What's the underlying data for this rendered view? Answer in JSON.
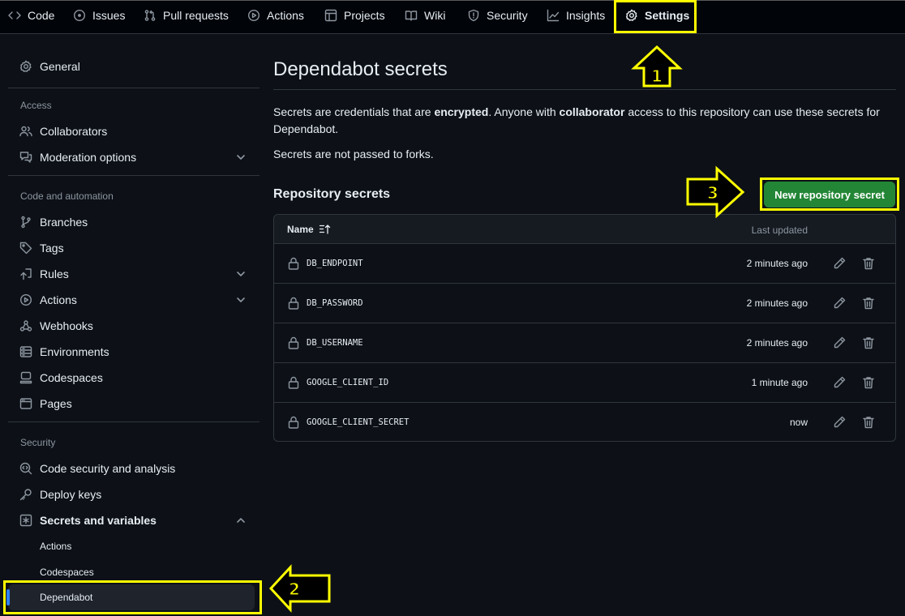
{
  "topnav": {
    "tabs": [
      {
        "label": "Code",
        "icon": "code-icon"
      },
      {
        "label": "Issues",
        "icon": "issue-icon"
      },
      {
        "label": "Pull requests",
        "icon": "pull-request-icon"
      },
      {
        "label": "Actions",
        "icon": "play-icon"
      },
      {
        "label": "Projects",
        "icon": "table-icon"
      },
      {
        "label": "Wiki",
        "icon": "book-icon"
      },
      {
        "label": "Security",
        "icon": "shield-icon"
      },
      {
        "label": "Insights",
        "icon": "graph-icon"
      },
      {
        "label": "Settings",
        "icon": "gear-icon",
        "active": true
      }
    ]
  },
  "sidebar": {
    "general": "General",
    "access_heading": "Access",
    "collaborators": "Collaborators",
    "moderation": "Moderation options",
    "code_heading": "Code and automation",
    "branches": "Branches",
    "tags": "Tags",
    "rules": "Rules",
    "actions": "Actions",
    "webhooks": "Webhooks",
    "environments": "Environments",
    "codespaces": "Codespaces",
    "pages": "Pages",
    "security_heading": "Security",
    "code_security": "Code security and analysis",
    "deploy_keys": "Deploy keys",
    "secrets_vars": "Secrets and variables",
    "sub_actions": "Actions",
    "sub_codespaces": "Codespaces",
    "sub_dependabot": "Dependabot"
  },
  "main": {
    "title": "Dependabot secrets",
    "desc_1": "Secrets are credentials that are ",
    "desc_bold_1": "encrypted",
    "desc_2": ". Anyone with ",
    "desc_bold_2": "collaborator",
    "desc_3": " access to this repository can use these secrets for Dependabot.",
    "desc_forks": "Secrets are not passed to forks.",
    "repo_secrets_heading": "Repository secrets",
    "new_secret_button": "New repository secret",
    "table": {
      "col_name": "Name",
      "col_updated": "Last updated",
      "rows": [
        {
          "name": "DB_ENDPOINT",
          "updated": "2 minutes ago"
        },
        {
          "name": "DB_PASSWORD",
          "updated": "2 minutes ago"
        },
        {
          "name": "DB_USERNAME",
          "updated": "2 minutes ago"
        },
        {
          "name": "GOOGLE_CLIENT_ID",
          "updated": "1 minute ago"
        },
        {
          "name": "GOOGLE_CLIENT_SECRET",
          "updated": "now"
        }
      ]
    }
  },
  "annotations": {
    "step1": "1",
    "step2": "2",
    "step3": "3",
    "color": "#ffff00"
  },
  "colors": {
    "background": "#0d1117",
    "accent_green": "#238636",
    "accent_blue": "#2f81f7"
  }
}
